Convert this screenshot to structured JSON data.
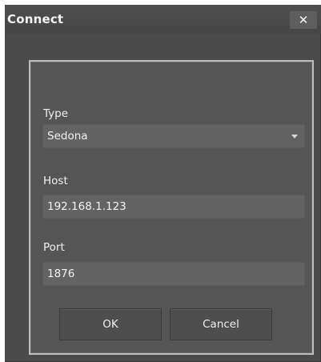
{
  "window": {
    "title": "Connect",
    "close_glyph": "✕"
  },
  "form": {
    "type_label": "Type",
    "type_value": "Sedona",
    "host_label": "Host",
    "host_value": "192.168.1.123",
    "port_label": "Port",
    "port_value": "1876"
  },
  "buttons": {
    "ok_label": "OK",
    "cancel_label": "Cancel"
  },
  "icons": {
    "close": "close-icon",
    "dropdown": "chevron-down-icon"
  },
  "colors": {
    "dialog_bg": "#4b4b4b",
    "panel_bg": "#555555",
    "panel_border": "#bdbdbd",
    "field_bg": "#636363",
    "text": "#f0f0f0"
  }
}
